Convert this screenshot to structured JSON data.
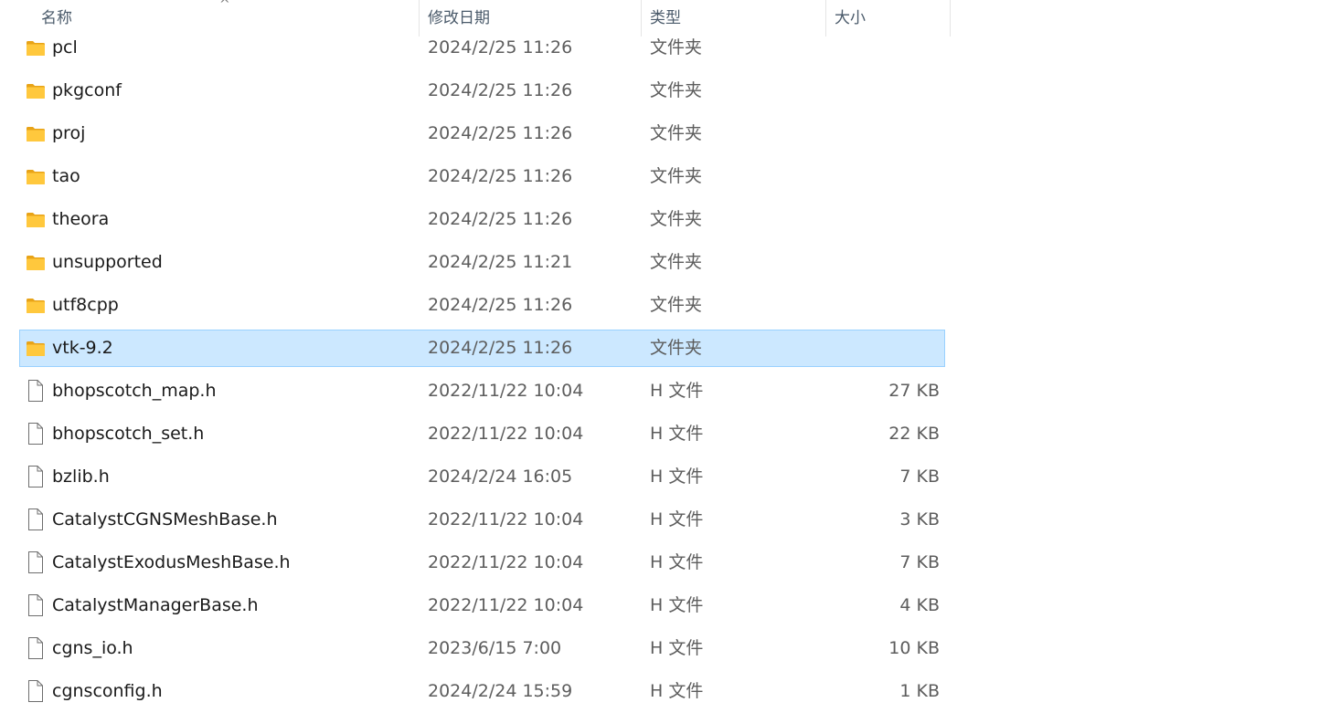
{
  "columns": {
    "name": "名称",
    "date": "修改日期",
    "type": "类型",
    "size": "大小",
    "sort_arrow": "^"
  },
  "files": [
    {
      "name": "pcl",
      "date": "2024/2/25 11:26",
      "type": "文件夹",
      "size": "",
      "icon": "folder-icon"
    },
    {
      "name": "pkgconf",
      "date": "2024/2/25 11:26",
      "type": "文件夹",
      "size": "",
      "icon": "folder-icon"
    },
    {
      "name": "proj",
      "date": "2024/2/25 11:26",
      "type": "文件夹",
      "size": "",
      "icon": "folder-icon"
    },
    {
      "name": "tao",
      "date": "2024/2/25 11:26",
      "type": "文件夹",
      "size": "",
      "icon": "folder-icon"
    },
    {
      "name": "theora",
      "date": "2024/2/25 11:26",
      "type": "文件夹",
      "size": "",
      "icon": "folder-icon"
    },
    {
      "name": "unsupported",
      "date": "2024/2/25 11:21",
      "type": "文件夹",
      "size": "",
      "icon": "folder-icon"
    },
    {
      "name": "utf8cpp",
      "date": "2024/2/25 11:26",
      "type": "文件夹",
      "size": "",
      "icon": "folder-icon"
    },
    {
      "name": "vtk-9.2",
      "date": "2024/2/25 11:26",
      "type": "文件夹",
      "size": "",
      "icon": "folder-icon",
      "selected": true
    },
    {
      "name": "bhopscotch_map.h",
      "date": "2022/11/22 10:04",
      "type": "H 文件",
      "size": "27 KB",
      "icon": "file-icon"
    },
    {
      "name": "bhopscotch_set.h",
      "date": "2022/11/22 10:04",
      "type": "H 文件",
      "size": "22 KB",
      "icon": "file-icon"
    },
    {
      "name": "bzlib.h",
      "date": "2024/2/24 16:05",
      "type": "H 文件",
      "size": "7 KB",
      "icon": "file-icon"
    },
    {
      "name": "CatalystCGNSMeshBase.h",
      "date": "2022/11/22 10:04",
      "type": "H 文件",
      "size": "3 KB",
      "icon": "file-icon"
    },
    {
      "name": "CatalystExodusMeshBase.h",
      "date": "2022/11/22 10:04",
      "type": "H 文件",
      "size": "7 KB",
      "icon": "file-icon"
    },
    {
      "name": "CatalystManagerBase.h",
      "date": "2022/11/22 10:04",
      "type": "H 文件",
      "size": "4 KB",
      "icon": "file-icon"
    },
    {
      "name": "cgns_io.h",
      "date": "2023/6/15 7:00",
      "type": "H 文件",
      "size": "10 KB",
      "icon": "file-icon"
    },
    {
      "name": "cgnsconfig.h",
      "date": "2024/2/24 15:59",
      "type": "H 文件",
      "size": "1 KB",
      "icon": "file-icon"
    }
  ],
  "colors": {
    "selection_fill": "#cce8ff",
    "selection_border": "#99d1ff",
    "folder_yellow": "#ffc83d"
  }
}
